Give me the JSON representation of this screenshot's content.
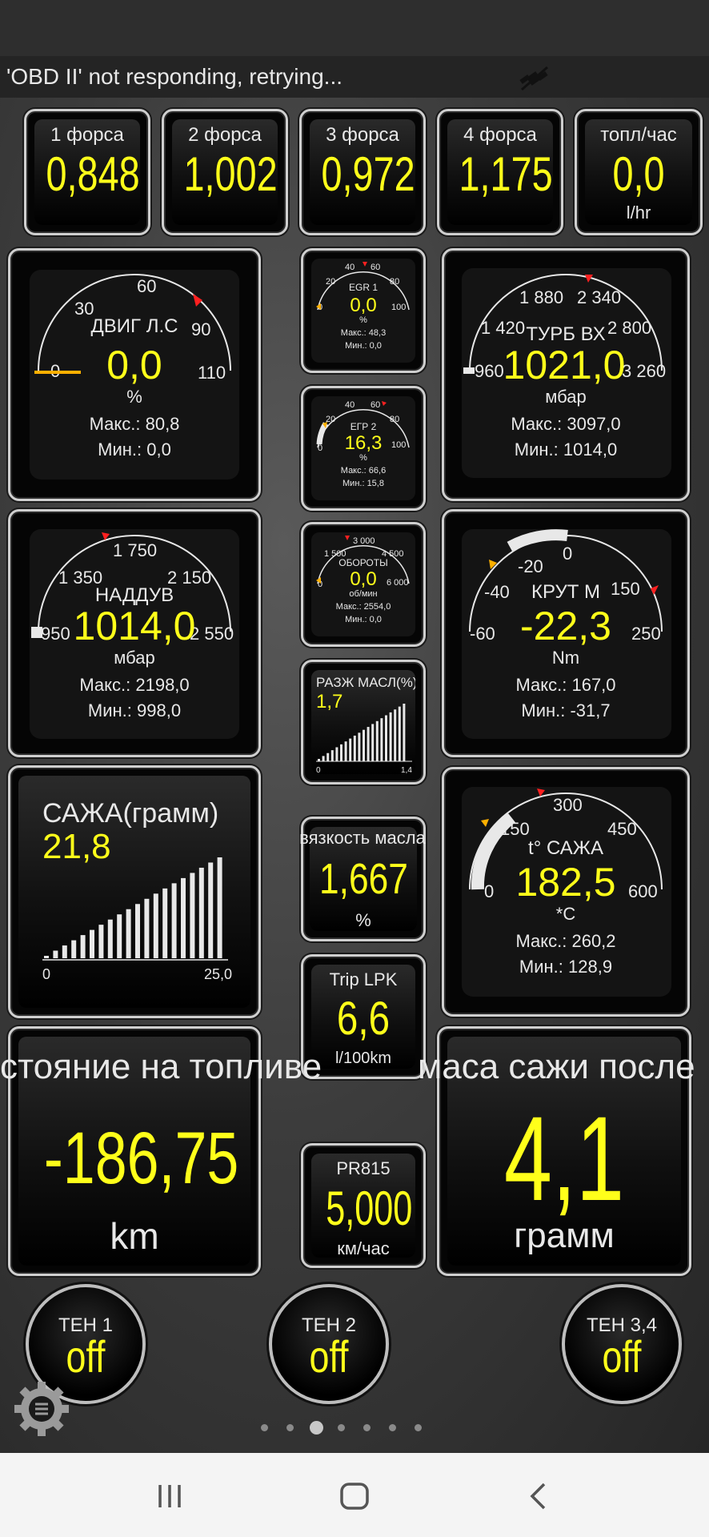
{
  "status_message": "'OBD II' not responding, retrying...",
  "boost_small": [
    {
      "label": "1 форса",
      "value": "0,848"
    },
    {
      "label": "2 форса",
      "value": "1,002"
    },
    {
      "label": "3 форса",
      "value": "0,972"
    },
    {
      "label": "4 форса",
      "value": "1,175"
    }
  ],
  "fuel_rate": {
    "label": "топл/час",
    "value": "0,0",
    "unit": "l/hr"
  },
  "engine_hp": {
    "label": "ДВИГ Л.С",
    "value": "0,0",
    "unit": "%",
    "max": "Макс.: 80,8",
    "min": "Мин.: 0,0",
    "ticks": [
      "0",
      "30",
      "60",
      "90",
      "110"
    ]
  },
  "egr1": {
    "label": "EGR 1",
    "value": "0,0",
    "unit": "%",
    "max": "Макс.: 48,3",
    "min": "Мин.: 0,0",
    "ticks": [
      "0",
      "20",
      "40",
      "60",
      "80",
      "100"
    ]
  },
  "egr2": {
    "label": "ЕГР 2",
    "value": "16,3",
    "unit": "%",
    "max": "Макс.: 66,6",
    "min": "Мин.: 15,8",
    "ticks": [
      "0",
      "20",
      "40",
      "60",
      "80",
      "100"
    ]
  },
  "turbo_in": {
    "label": "ТУРБ ВХ",
    "value": "1021,0",
    "unit": "мбар",
    "max": "Макс.: 3097,0",
    "min": "Мин.: 1014,0",
    "ticks": [
      "960",
      "1 420",
      "1 880",
      "2 340",
      "2 800",
      "3 260"
    ]
  },
  "boost": {
    "label": "НАДДУВ",
    "value": "1014,0",
    "unit": "мбар",
    "max": "Макс.: 2198,0",
    "min": "Мин.: 998,0",
    "ticks": [
      "950",
      "1 350",
      "1 750",
      "2 150",
      "2 550"
    ]
  },
  "rpm": {
    "label": "ОБОРОТЫ",
    "value": "0,0",
    "unit": "об/мин",
    "max": "Макс.: 2554,0",
    "min": "Мин.: 0,0",
    "ticks": [
      "0",
      "1 500",
      "3 000",
      "4 500",
      "6 000"
    ]
  },
  "torque": {
    "label": "КРУТ М",
    "value": "-22,3",
    "unit": "Nm",
    "max": "Макс.: 167,0",
    "min": "Мин.: -31,7",
    "ticks": [
      "-60",
      "-40",
      "-20",
      "0",
      "150",
      "250"
    ]
  },
  "oil_dilution": {
    "label": "РАЗЖ МАСЛ(%)",
    "value": "1,7",
    "axis_min": "0",
    "axis_max": "1,4"
  },
  "soot": {
    "label": "САЖА(грамм)",
    "value": "21,8",
    "axis_min": "0",
    "axis_max": "25,0"
  },
  "oil_viscosity": {
    "label": "вязкость масла",
    "value": "1,667",
    "unit": "%"
  },
  "soot_temp": {
    "label": "t° САЖА",
    "value": "182,5",
    "unit": "*C",
    "max": "Макс.: 260,2",
    "min": "Мин.: 128,9",
    "ticks": [
      "0",
      "150",
      "300",
      "450",
      "600"
    ]
  },
  "trip_lpk": {
    "label": "Trip LPK",
    "value": "6,6",
    "unit": "l/100km"
  },
  "fuel_range": {
    "label": "стояние на топливе",
    "value": "-186,75",
    "unit": "km"
  },
  "soot_after": {
    "label": "маса сажи после",
    "value": "4,1",
    "unit": "грамм"
  },
  "pr815": {
    "label": "PR815",
    "value": "5,000",
    "unit": "км/час"
  },
  "heaters": [
    {
      "label": "ТЕН 1",
      "value": "off"
    },
    {
      "label": "ТЕН 2",
      "value": "off"
    },
    {
      "label": "ТЕН 3,4",
      "value": "off"
    }
  ],
  "colors": {
    "value": "#ffff1a",
    "text": "#e8e8e8",
    "needle_red": "#ff2020",
    "needle_orange": "#ffb000"
  },
  "icons": [
    "satellite-off-icon",
    "settings-gear-icon",
    "menu-icon",
    "recent-apps-icon",
    "home-icon",
    "back-icon"
  ]
}
